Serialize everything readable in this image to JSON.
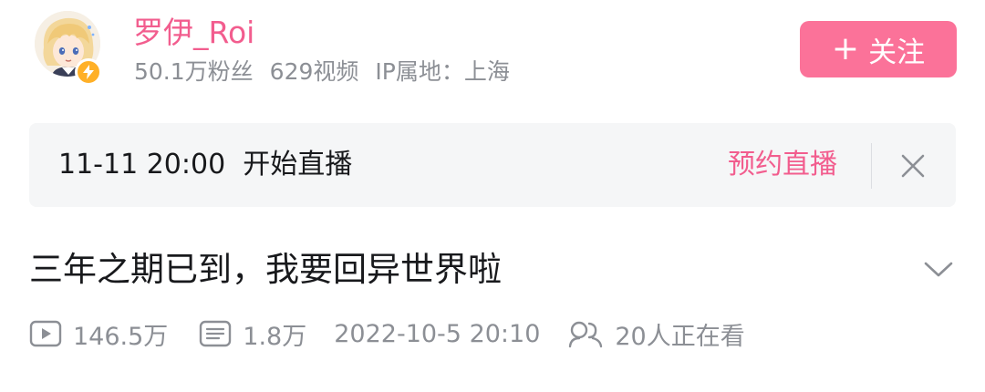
{
  "uploader": {
    "name": "罗伊_Roi",
    "followers": "50.1万粉丝",
    "videos": "629视频",
    "ip_location": "IP属地：上海",
    "follow_button": {
      "icon": "plus-icon",
      "label": "关注"
    },
    "avatar_icon": "avatar-anime-character",
    "badge_icon": "lightning-verified-icon"
  },
  "live_reservation": {
    "time_text": "11-11 20:00  开始直播",
    "reserve_label": "预约直播",
    "close_icon": "close-icon"
  },
  "video": {
    "title": "三年之期已到，我要回异世界啦",
    "expand_icon": "chevron-down-icon",
    "stats": {
      "views": "146.5万",
      "danmaku": "1.8万",
      "publish_time": "2022-10-5 20:10",
      "watching_now": "20人正在看"
    }
  },
  "colors": {
    "accent_pink": "#fb7299",
    "name_pink": "#f25d8e",
    "muted_gray": "#8c8f95",
    "panel_bg": "#f5f6f7",
    "badge_yellow": "#ffb027"
  }
}
